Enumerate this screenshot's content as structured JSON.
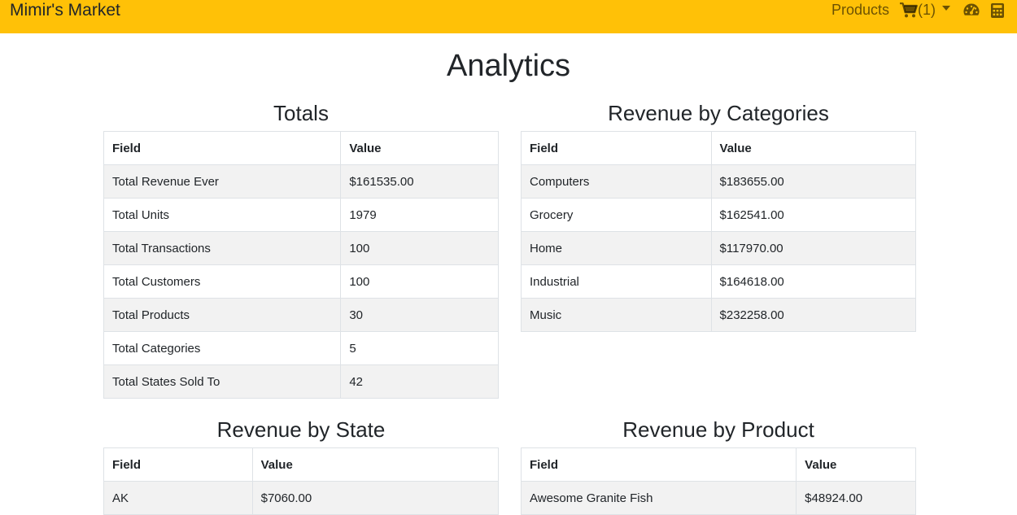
{
  "navbar": {
    "brand": "Mimir's Market",
    "products_label": "Products",
    "cart_count": "(1)",
    "icons": [
      "cart-icon",
      "gauge-icon",
      "calculator-icon"
    ],
    "bg_color": "#ffc107"
  },
  "page": {
    "title": "Analytics"
  },
  "totals": {
    "title": "Totals",
    "headers": [
      "Field",
      "Value"
    ],
    "rows": [
      [
        "Total Revenue Ever",
        "$161535.00"
      ],
      [
        "Total Units",
        "1979"
      ],
      [
        "Total Transactions",
        "100"
      ],
      [
        "Total Customers",
        "100"
      ],
      [
        "Total Products",
        "30"
      ],
      [
        "Total Categories",
        "5"
      ],
      [
        "Total States Sold To",
        "42"
      ]
    ]
  },
  "categories": {
    "title": "Revenue by Categories",
    "headers": [
      "Field",
      "Value"
    ],
    "rows": [
      [
        "Computers",
        "$183655.00"
      ],
      [
        "Grocery",
        "$162541.00"
      ],
      [
        "Home",
        "$117970.00"
      ],
      [
        "Industrial",
        "$164618.00"
      ],
      [
        "Music",
        "$232258.00"
      ]
    ]
  },
  "state": {
    "title": "Revenue by State",
    "headers": [
      "Field",
      "Value"
    ],
    "rows": [
      [
        "AK",
        "$7060.00"
      ]
    ]
  },
  "product": {
    "title": "Revenue by Product",
    "headers": [
      "Field",
      "Value"
    ],
    "rows": [
      [
        "Awesome Granite Fish",
        "$48924.00"
      ]
    ]
  }
}
